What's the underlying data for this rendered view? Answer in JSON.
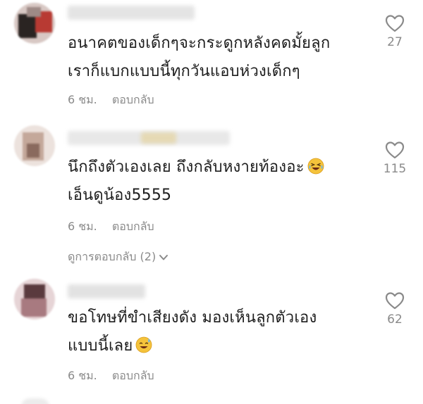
{
  "comments": [
    {
      "lines": [
        "อนาคตของเด็กๆจะกระดูกหลังคดมั้ยลูก",
        "เราก็แบกแบบนี้ทุกวันแอบห่วงเด็กๆ"
      ],
      "time": "6 ชม.",
      "reply_label": "ตอบกลับ",
      "likes": "27",
      "avatar_colors": [
        "#c9b4b0",
        "#2a2422",
        "#b83a33"
      ],
      "username_color": "#e4e4e4",
      "emoji": ""
    },
    {
      "lines": [
        "นึกถึงตัวเองเลย ถึงกลับหงายท้องอะ",
        "เอ็นดูน้อง5555"
      ],
      "time": "6 ชม.",
      "reply_label": "ตอบกลับ",
      "likes": "115",
      "avatar_colors": [
        "#e9dcd6",
        "#c4a89a",
        "#8a6a5e"
      ],
      "username_color": "#e8e8e8",
      "emoji": "laughing-tears"
    },
    {
      "lines": [
        "ขอโทษที่ขำเสียงดัง มองเห็นลูกตัวเอง",
        "แบบนี้เลย"
      ],
      "time": "6 ชม.",
      "reply_label": "ตอบกลับ",
      "likes": "62",
      "avatar_colors": [
        "#e2cfd2",
        "#5a3a3e",
        "#a87a80"
      ],
      "username_color": "#e2e2e2",
      "emoji": "sweat-smile"
    }
  ],
  "view_replies": {
    "label": "ดูการตอบกลับ (2)",
    "icon": "chevron-down-icon"
  },
  "icons": {
    "like": "heart-outline-icon"
  },
  "colors": {
    "text": "#1d1d1d",
    "meta": "#8a8a8a",
    "background": "#ffffff"
  }
}
